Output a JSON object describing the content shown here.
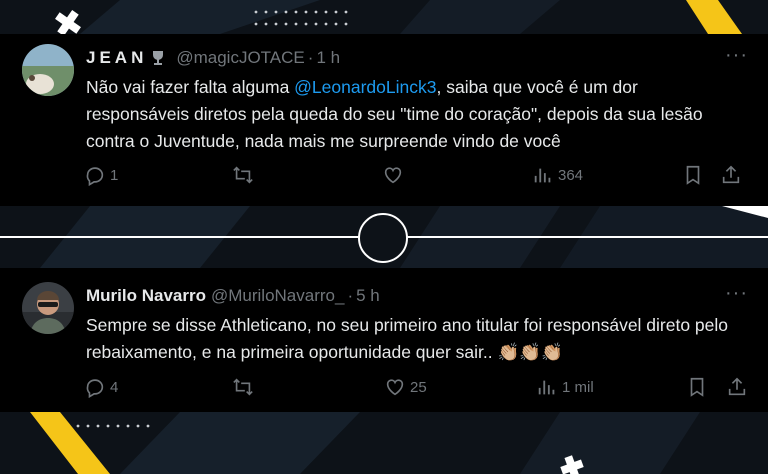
{
  "tweets": [
    {
      "name": "JEAN",
      "handle": "@magicJOTACE",
      "separator": "·",
      "time": "1 h",
      "text_before": "Não vai fazer falta alguma ",
      "mention": "@LeonardoLinck3",
      "text_after": ", saiba que você é um dor responsáveis diretos pela queda do seu \"time do coração\", depois da sua lesão contra o Juventude, nada mais me surpreende vindo de você",
      "replies": "1",
      "retweets": "",
      "likes": "",
      "views": "364"
    },
    {
      "name": "Murilo Navarro",
      "handle": "@MuriloNavarro_",
      "separator": "·",
      "time": "5 h",
      "text": "Sempre se disse Athleticano, no seu primeiro ano titular foi responsável direto pelo rebaixamento, e na primeira oportunidade quer sair..",
      "emoji": "👏🏼👏🏼👏🏼",
      "replies": "4",
      "retweets": "",
      "likes": "25",
      "views": "1 mil"
    }
  ],
  "more_label": "···",
  "colors": {
    "card_bg": "#000000",
    "text": "#e7e9ea",
    "muted": "#71767b",
    "link": "#1d9bf0",
    "accent_yellow": "#f5c518",
    "page_bg": "#0d1218"
  }
}
